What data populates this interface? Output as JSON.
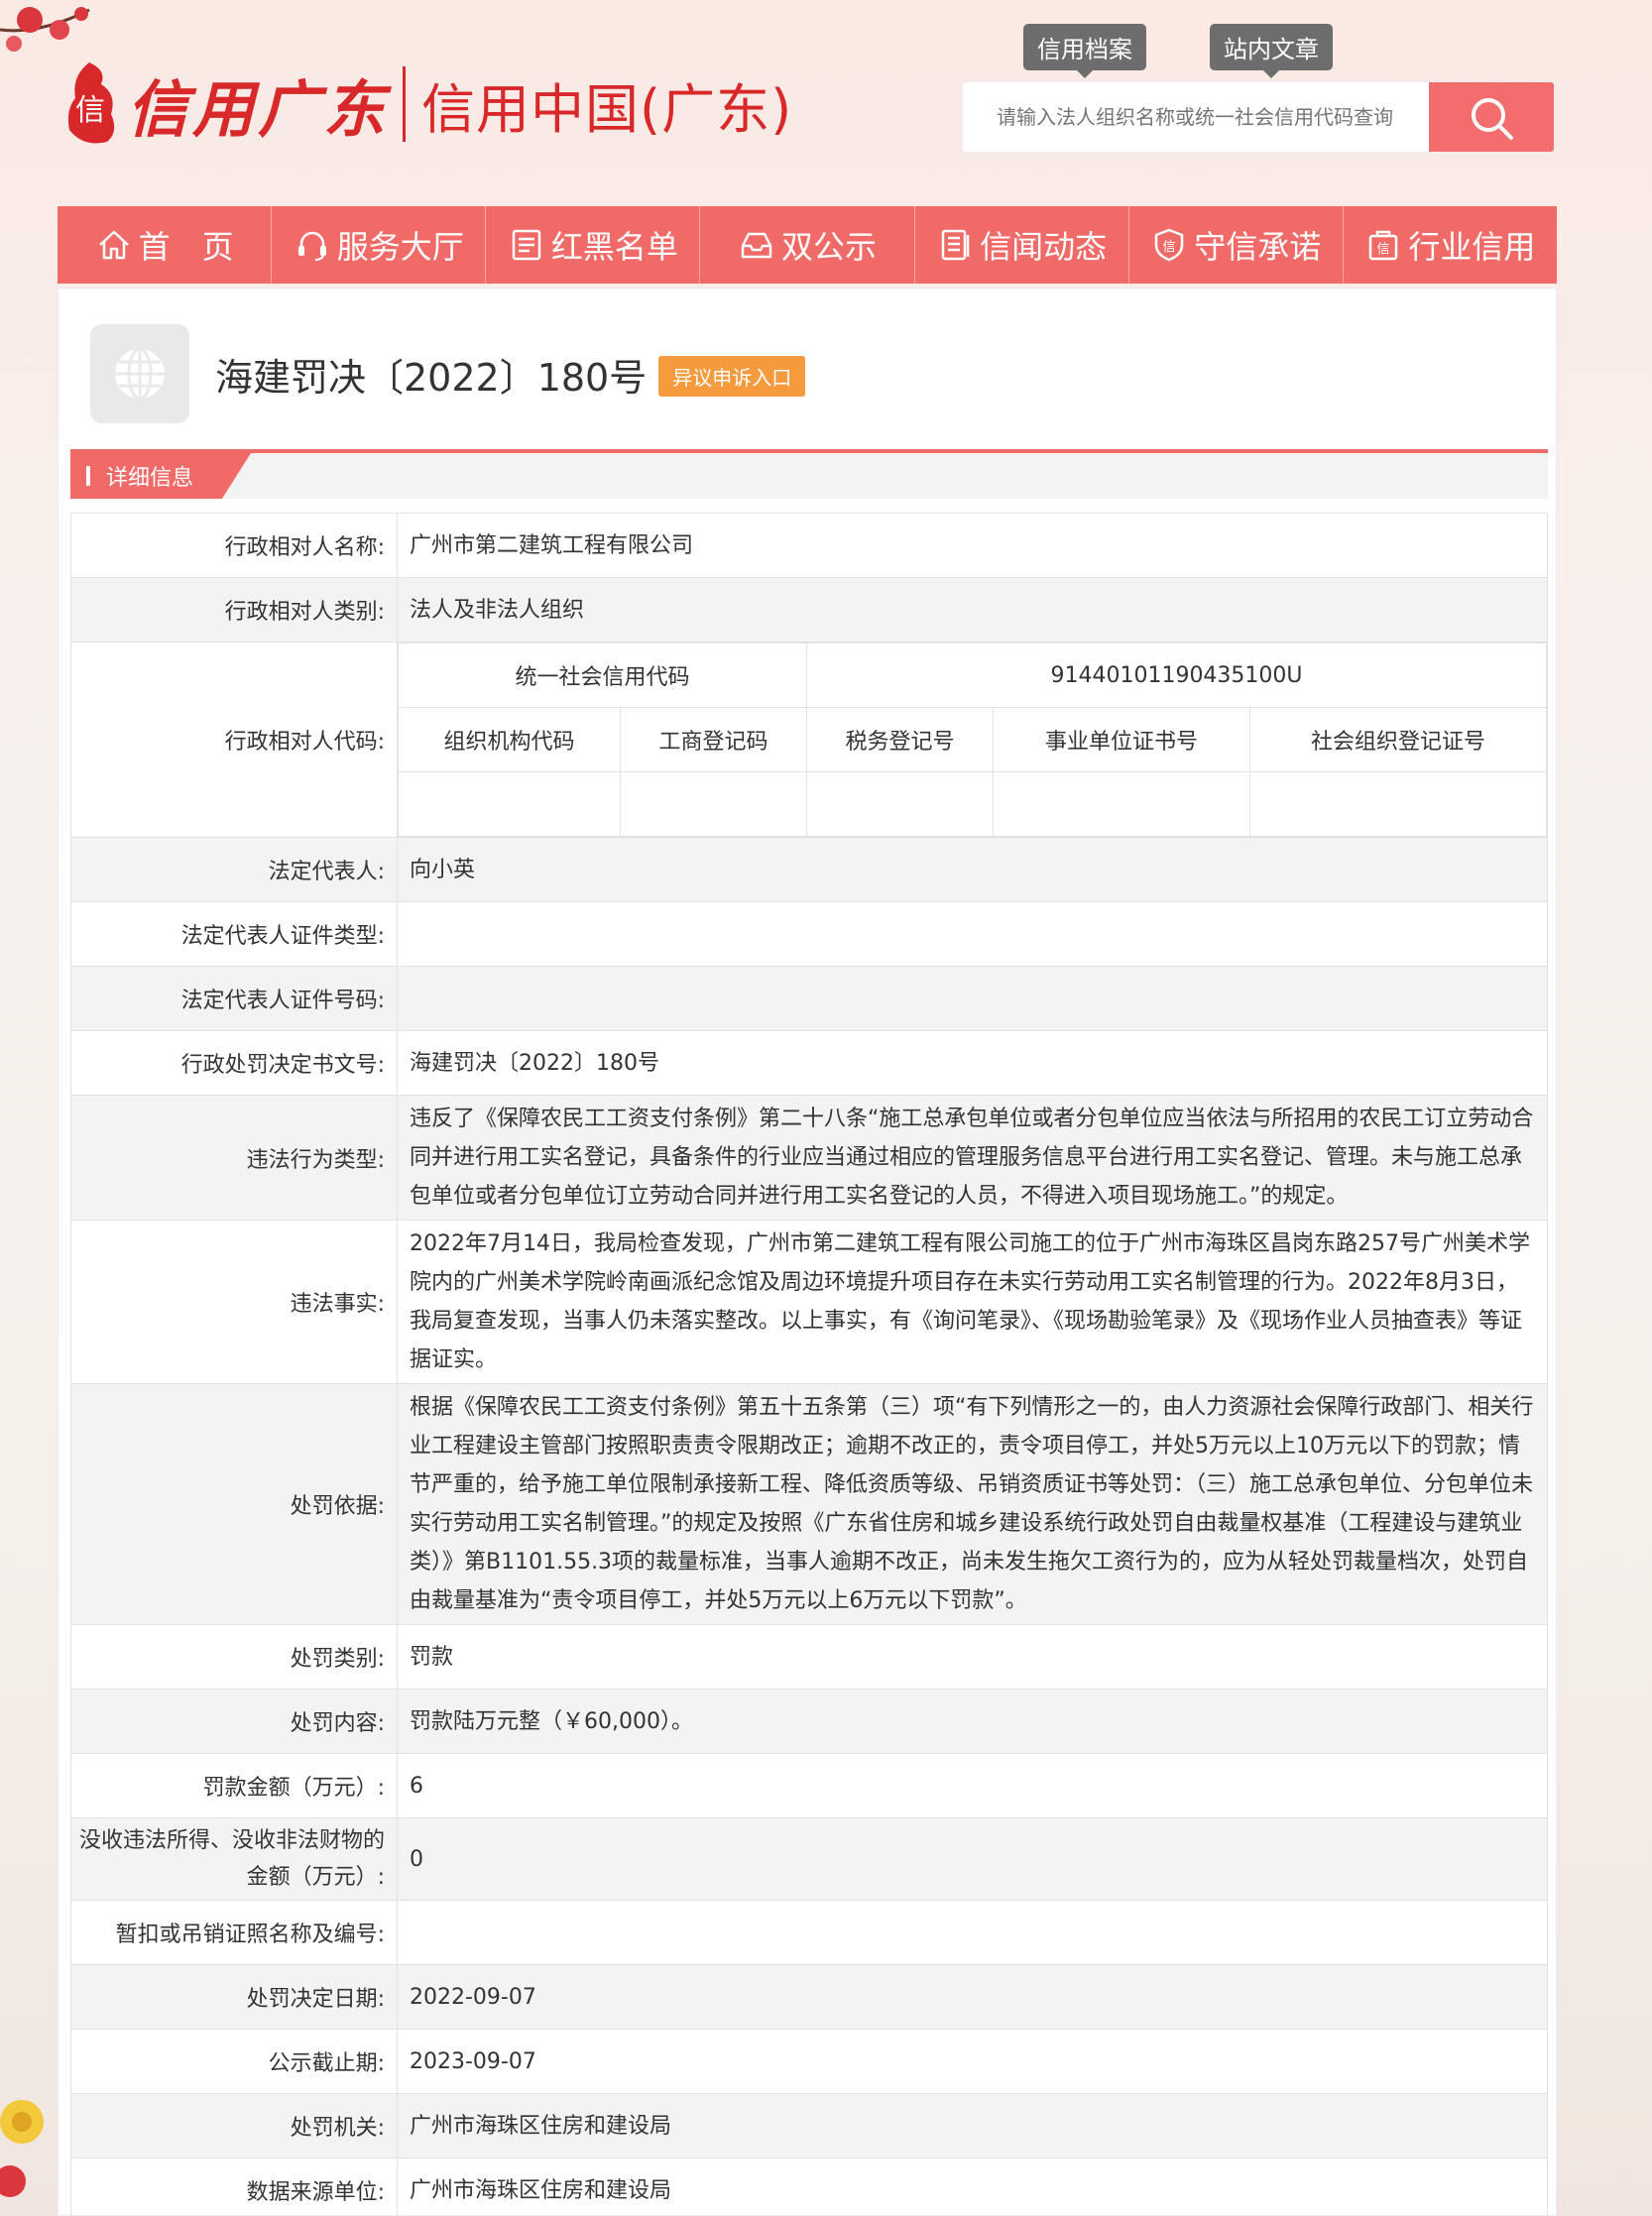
{
  "header": {
    "logo_script": "信用广东",
    "logo_name": "信用中国(广东)",
    "top_tabs": [
      "信用档案",
      "站内文章"
    ],
    "search_placeholder": "请输入法人组织名称或统一社会信用代码查询"
  },
  "nav": [
    {
      "label": "首　页",
      "icon": "home-icon"
    },
    {
      "label": "服务大厅",
      "icon": "headset-icon"
    },
    {
      "label": "红黑名单",
      "icon": "list-icon"
    },
    {
      "label": "双公示",
      "icon": "inbox-icon"
    },
    {
      "label": "信闻动态",
      "icon": "document-icon"
    },
    {
      "label": "守信承诺",
      "icon": "shield-icon"
    },
    {
      "label": "行业信用",
      "icon": "building-icon"
    }
  ],
  "record": {
    "title": "海建罚决〔2022〕180号",
    "appeal_label": "异议申诉入口",
    "section_label": "详细信息"
  },
  "fields": {
    "party_name": {
      "label": "行政相对人名称:",
      "value": "广州市第二建筑工程有限公司"
    },
    "party_type": {
      "label": "行政相对人类别:",
      "value": "法人及非法人组织"
    },
    "party_code": {
      "label": "行政相对人代码:"
    },
    "codes": {
      "usc_label": "统一社会信用代码",
      "usc_value": "91440101190435100U",
      "org_code_label": "组织机构代码",
      "biz_reg_label": "工商登记码",
      "tax_reg_label": "税务登记号",
      "inst_cert_label": "事业单位证书号",
      "social_org_label": "社会组织登记证号",
      "org_code_value": "",
      "biz_reg_value": "",
      "tax_reg_value": "",
      "inst_cert_value": "",
      "social_org_value": ""
    },
    "legal_rep": {
      "label": "法定代表人:",
      "value": "向小英"
    },
    "legal_rep_id_type": {
      "label": "法定代表人证件类型:",
      "value": ""
    },
    "legal_rep_id_no": {
      "label": "法定代表人证件号码:",
      "value": ""
    },
    "decision_no": {
      "label": "行政处罚决定书文号:",
      "value": "海建罚决〔2022〕180号"
    },
    "violation_type": {
      "label": "违法行为类型:",
      "value": "违反了《保障农民工工资支付条例》第二十八条“施工总承包单位或者分包单位应当依法与所招用的农民工订立劳动合同并进行用工实名登记，具备条件的行业应当通过相应的管理服务信息平台进行用工实名登记、管理。未与施工总承包单位或者分包单位订立劳动合同并进行用工实名登记的人员，不得进入项目现场施工。”的规定。"
    },
    "violation_facts": {
      "label": "违法事实:",
      "value": "2022年7月14日，我局检查发现，广州市第二建筑工程有限公司施工的位于广州市海珠区昌岗东路257号广州美术学院内的广州美术学院岭南画派纪念馆及周边环境提升项目存在未实行劳动用工实名制管理的行为。2022年8月3日，我局复查发现，当事人仍未落实整改。以上事实，有《询问笔录》、《现场勘验笔录》及《现场作业人员抽查表》等证据证实。"
    },
    "penalty_basis": {
      "label": "处罚依据:",
      "value": "根据《保障农民工工资支付条例》第五十五条第（三）项“有下列情形之一的，由人力资源社会保障行政部门、相关行业工程建设主管部门按照职责责令限期改正；逾期不改正的，责令项目停工，并处5万元以上10万元以下的罚款；情节严重的，给予施工单位限制承接新工程、降低资质等级、吊销资质证书等处罚：（三）施工总承包单位、分包单位未实行劳动用工实名制管理。”的规定及按照《广东省住房和城乡建设系统行政处罚自由裁量权基准（工程建设与建筑业类）》第B1101.55.3项的裁量标准，当事人逾期不改正，尚未发生拖欠工资行为的，应为从轻处罚裁量档次，处罚自由裁量基准为“责令项目停工，并处5万元以上6万元以下罚款”。"
    },
    "penalty_category": {
      "label": "处罚类别:",
      "value": "罚款"
    },
    "penalty_content": {
      "label": "处罚内容:",
      "value": "罚款陆万元整（￥60,000）。"
    },
    "fine_amount": {
      "label": "罚款金额（万元）:",
      "value": "6"
    },
    "confiscation_amount": {
      "label": "没收违法所得、没收非法财物的金额（万元）:",
      "value": "0"
    },
    "license_revoked": {
      "label": "暂扣或吊销证照名称及编号:",
      "value": ""
    },
    "decision_date": {
      "label": "处罚决定日期:",
      "value": "2022-09-07"
    },
    "publicity_end": {
      "label": "公示截止期:",
      "value": "2023-09-07"
    },
    "authority": {
      "label": "处罚机关:",
      "value": "广州市海珠区住房和建设局"
    },
    "data_source": {
      "label": "数据来源单位:",
      "value": "广州市海珠区住房和建设局"
    }
  },
  "colors": {
    "brand_red": "#f06b68",
    "logo_red": "#d8282a",
    "appeal_orange": "#f59a3d"
  }
}
